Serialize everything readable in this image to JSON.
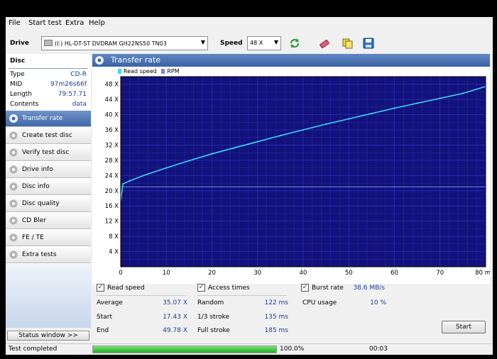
{
  "menu": [
    "File",
    "Start test",
    "Extra",
    "Help"
  ],
  "toolbar": {
    "drive_label": "Drive",
    "drive_value": "(I:)  HL-DT-ST DVDRAM GH22NS50 TN03",
    "speed_label": "Speed",
    "speed_value": "48 X",
    "icons": [
      "refresh-icon",
      "erase-icon",
      "copy-icon",
      "save-icon"
    ]
  },
  "disc": {
    "title": "Disc",
    "rows": [
      {
        "k": "Type",
        "v": "CD-R"
      },
      {
        "k": "MID",
        "v": "97m26s66f"
      },
      {
        "k": "Length",
        "v": "79:57.71"
      },
      {
        "k": "Contents",
        "v": "data"
      }
    ]
  },
  "nav": [
    {
      "label": "Transfer rate",
      "active": true
    },
    {
      "label": "Create test disc",
      "active": false
    },
    {
      "label": "Verify test disc",
      "active": false
    },
    {
      "label": "Drive info",
      "active": false
    },
    {
      "label": "Disc info",
      "active": false
    },
    {
      "label": "Disc quality",
      "active": false
    },
    {
      "label": "CD Bler",
      "active": false
    },
    {
      "label": "FE / TE",
      "active": false
    },
    {
      "label": "Extra tests",
      "active": false
    }
  ],
  "status_window_label": "Status window >>",
  "panel_title": "Transfer rate",
  "legend": {
    "read_speed": "Read speed",
    "rpm": "RPM"
  },
  "colors": {
    "plot_bg": "#12127a",
    "read_speed": "#3fd6ee",
    "rpm": "#6f8fe0",
    "grid": "#2a2ac0",
    "accent": "#4a72b4"
  },
  "chart_data": {
    "type": "line",
    "x_tick_labels": [
      "0",
      "10",
      "20",
      "30",
      "40",
      "50",
      "60",
      "70",
      "80 min"
    ],
    "y_tick_labels": [
      "4 X",
      "8 X",
      "12 X",
      "16 X",
      "20 X",
      "24 X",
      "28 X",
      "32 X",
      "36 X",
      "40 X",
      "44 X",
      "48 X"
    ],
    "xlim": [
      0,
      80
    ],
    "ylim": [
      0,
      50
    ],
    "grid": true,
    "legend_position": "top-left",
    "series": [
      {
        "name": "Read speed",
        "x": [
          0,
          0.5,
          2,
          5,
          10,
          15,
          20,
          25,
          30,
          35,
          40,
          45,
          50,
          55,
          60,
          65,
          70,
          75,
          80
        ],
        "y": [
          17.4,
          21.8,
          22.6,
          24.0,
          26.0,
          27.9,
          29.7,
          31.3,
          32.9,
          34.5,
          36.0,
          37.5,
          38.9,
          40.3,
          41.7,
          43.0,
          44.3,
          45.6,
          47.4
        ]
      },
      {
        "name": "RPM",
        "x": [
          0,
          20,
          40,
          60,
          80
        ],
        "y": [
          21.0,
          21.0,
          21.0,
          21.0,
          21.0
        ]
      }
    ]
  },
  "stats": {
    "read_speed_label": "Read speed",
    "access_times_label": "Access times",
    "burst_rate_label": "Burst rate",
    "burst_rate_value": "38.6 MB/s",
    "average_label": "Average",
    "average_value": "35.07 X",
    "start_label": "Start",
    "start_value": "17.43 X",
    "end_label": "End",
    "end_value": "49.78 X",
    "random_label": "Random",
    "random_value": "122 ms",
    "third_label": "1/3 stroke",
    "third_value": "135 ms",
    "full_label": "Full stroke",
    "full_value": "185 ms",
    "cpu_label": "CPU usage",
    "cpu_value": "10 %",
    "start_button": "Start"
  },
  "statusbar": {
    "text": "Test completed",
    "progress": 1.0,
    "percent": "100.0%",
    "elapsed": "00:03"
  }
}
